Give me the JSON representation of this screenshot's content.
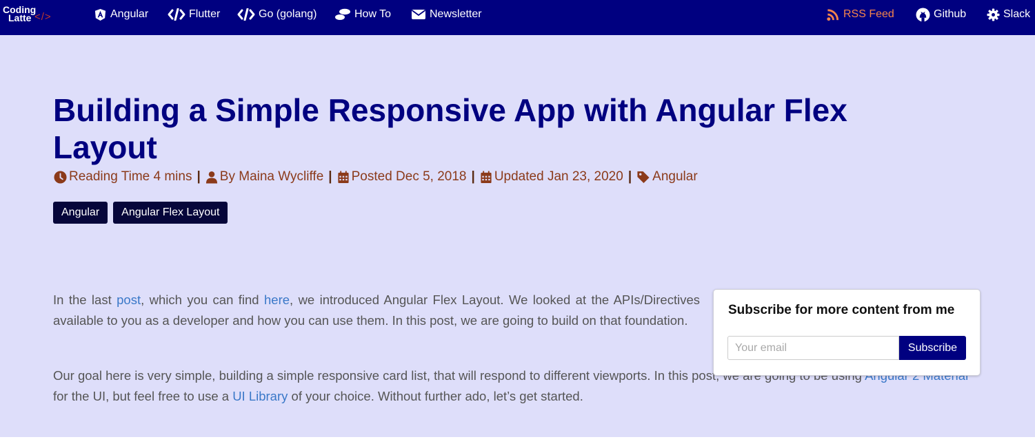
{
  "navbar": {
    "brand": {
      "line1": "Coding",
      "line2": "Latte",
      "tag": "</>"
    },
    "left_items": [
      {
        "label": "Angular",
        "icon": "angular-icon"
      },
      {
        "label": "Flutter",
        "icon": "code-icon"
      },
      {
        "label": "Go (golang)",
        "icon": "code-icon"
      },
      {
        "label": "How To",
        "icon": "shoe-prints-icon"
      },
      {
        "label": "Newsletter",
        "icon": "envelope-icon"
      }
    ],
    "right_items": [
      {
        "label": "RSS Feed",
        "icon": "rss-icon"
      },
      {
        "label": "Github",
        "icon": "github-icon"
      },
      {
        "label": "Slack",
        "icon": "gear-icon"
      }
    ]
  },
  "article": {
    "title": "Building a Simple Responsive App with Angular Flex Layout",
    "meta": {
      "reading_time": "Reading Time 4 mins",
      "author": "By Maina Wycliffe",
      "posted": "Posted Dec 5, 2018",
      "updated": "Updated Jan 23, 2020",
      "category": "Angular",
      "separator": "|"
    },
    "tags": [
      "Angular",
      "Angular Flex Layout"
    ],
    "paragraph1": {
      "t1": "In the last ",
      "link1": "post",
      "t2": ", which you can find ",
      "link2": "here",
      "t3": ", we introduced Angular Flex Layout. We looked at the APIs/Directives available to you as a developer and how you can use them. In this post, we are going to build on that foundation."
    },
    "paragraph2": {
      "t1": "Our goal here is very simple, building a simple responsive card list, that will respond to different viewports. In this post, we are going to be using ",
      "link1": "Angular 2 Material",
      "t2": " for the UI, but feel free to use a ",
      "link2": "UI Library",
      "t3": " of your choice. Without further ado, let’s get started."
    }
  },
  "subscribe": {
    "title": "Subscribe for more content from me",
    "placeholder": "Your email",
    "button": "Subscribe"
  },
  "colors": {
    "navbar_bg": "#000080",
    "hero_bg": "#dedefa",
    "title": "#000080",
    "meta": "#8b3a1a",
    "link": "#3a78c8",
    "rss": "#f4844c",
    "tag_bg": "#06063a"
  }
}
